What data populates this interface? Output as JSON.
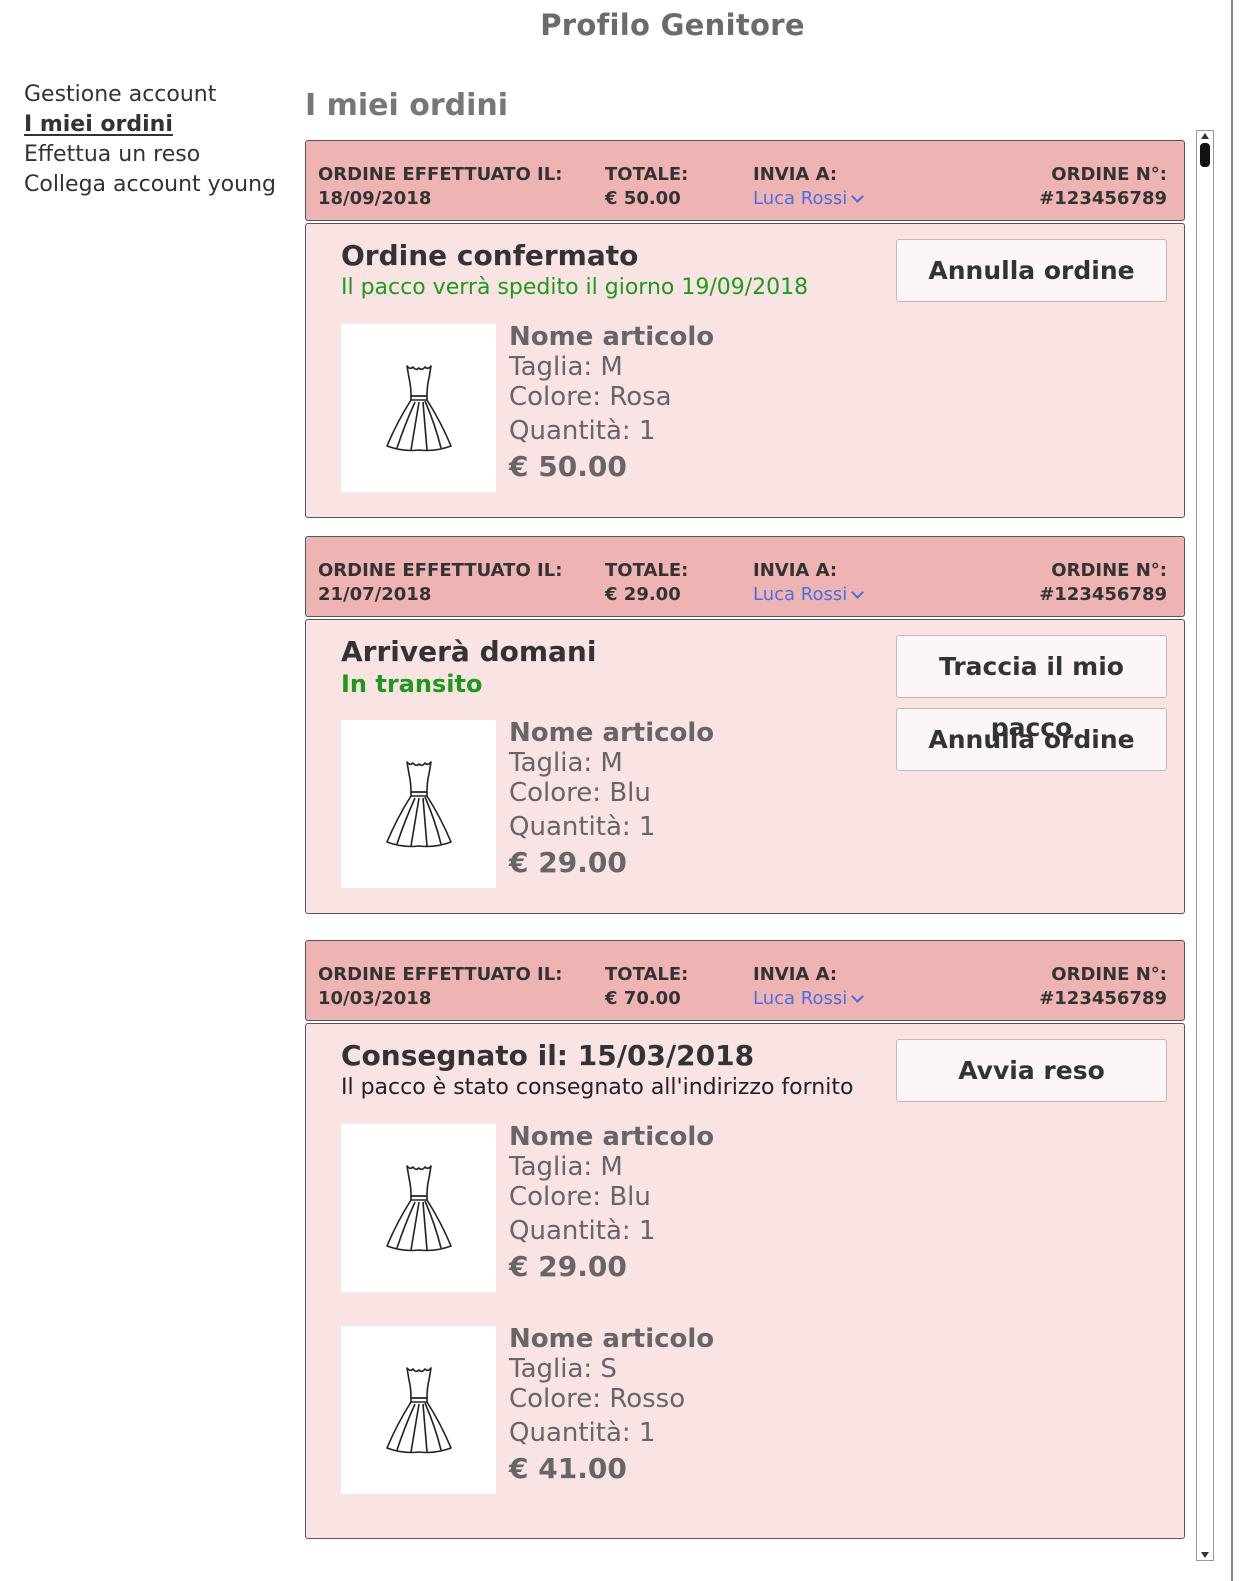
{
  "page": {
    "title": "Profilo Genitore"
  },
  "sidebar": {
    "items": [
      {
        "label": "Gestione account"
      },
      {
        "label": "I miei ordini"
      },
      {
        "label": "Effettua un reso"
      },
      {
        "label": "Collega account young"
      }
    ]
  },
  "section": {
    "title": "I miei ordini"
  },
  "labels": {
    "date": "ORDINE EFFETTUATO IL:",
    "total": "TOTALE:",
    "ship": "INVIA A:",
    "number": "ORDINE N°:"
  },
  "orders": [
    {
      "date": "18/09/2018",
      "total": "€ 50.00",
      "ship_to": "Luca Rossi",
      "number": "#123456789",
      "status_title": "Ordine confermato",
      "status_sub": "Il pacco verrà spedito il giorno 19/09/2018",
      "actions": [
        "Annulla ordine"
      ],
      "items": [
        {
          "name": "Nome articolo",
          "size": "Taglia: M",
          "color": "Colore: Rosa",
          "qty": "Quantità: 1",
          "price": "€ 50.00",
          "icon": "dress-icon"
        }
      ]
    },
    {
      "date": "21/07/2018",
      "total": "€ 29.00",
      "ship_to": "Luca Rossi",
      "number": "#123456789",
      "status_title": "Arriverà domani",
      "status_sub": "In transito",
      "actions": [
        "Traccia il mio pacco",
        "Annulla ordine"
      ],
      "items": [
        {
          "name": "Nome articolo",
          "size": "Taglia: M",
          "color": "Colore: Blu",
          "qty": "Quantità: 1",
          "price": "€ 29.00",
          "icon": "dress-icon"
        }
      ]
    },
    {
      "date": "10/03/2018",
      "total": "€ 70.00",
      "ship_to": "Luca Rossi",
      "number": "#123456789",
      "status_title": "Consegnato il: 15/03/2018",
      "status_sub": "Il pacco è stato consegnato all'indirizzo fornito",
      "actions": [
        "Avvia reso"
      ],
      "items": [
        {
          "name": "Nome articolo",
          "size": "Taglia: M",
          "color": "Colore: Blu",
          "qty": "Quantità: 1",
          "price": "€ 29.00",
          "icon": "dress-icon"
        },
        {
          "name": "Nome articolo",
          "size": "Taglia: S",
          "color": "Colore: Rosso",
          "qty": "Quantità: 1",
          "price": "€ 41.00",
          "icon": "dress-icon"
        }
      ]
    }
  ],
  "colors": {
    "header_bg": "#eeb4b4",
    "body_bg": "#f9e3e3",
    "status_green": "#1d9a1d",
    "link_blue": "#4a6ee0"
  }
}
